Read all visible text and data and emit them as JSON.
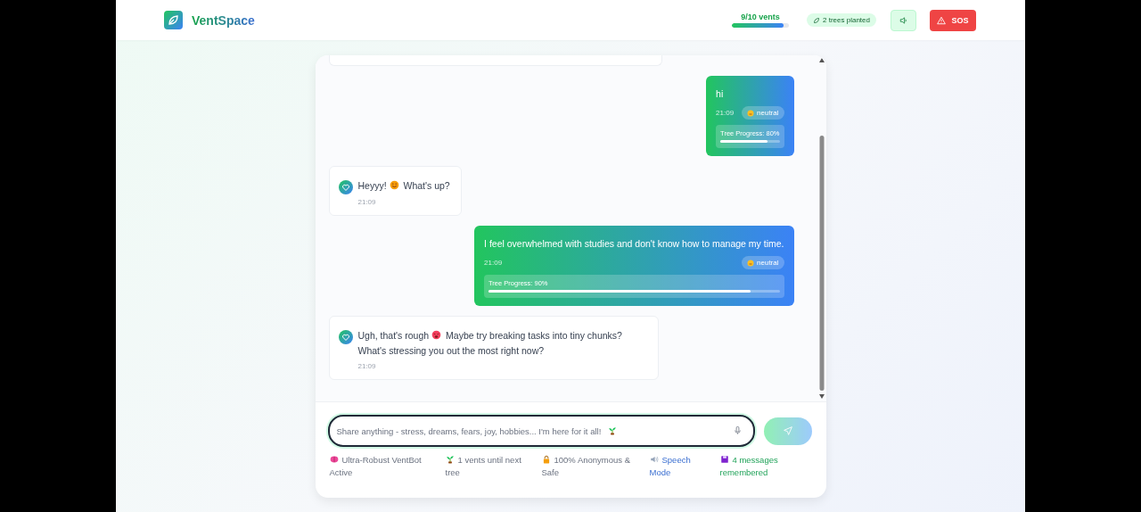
{
  "header": {
    "brand": "VentSpace",
    "vents": {
      "label": "9/10 vents",
      "level": 0.9
    },
    "trees_badge": "2 trees planted",
    "sos_button": "SOS"
  },
  "messages": [
    {
      "kind": "user",
      "parts": [
        {
          "kind": "text",
          "text": "hi"
        }
      ],
      "time": "21:09",
      "mood": "neutral",
      "progress": {
        "label": "Tree Progress: 80%",
        "level": 0.8
      }
    },
    {
      "kind": "bot",
      "parts": [
        {
          "kind": "text",
          "text": "Heyyy!"
        },
        {
          "kind": "smile"
        },
        {
          "kind": "text",
          "text": "What's up?"
        }
      ],
      "time": "21:09"
    },
    {
      "kind": "user",
      "parts": [
        {
          "kind": "text",
          "text": "I feel overwhelmed with studies and don't know how to manage my time."
        }
      ],
      "time": "21:09",
      "mood": "neutral",
      "progress": {
        "label": "Tree Progress: 90%",
        "level": 0.9
      }
    },
    {
      "kind": "bot",
      "parts": [
        {
          "kind": "text",
          "text": "Ugh, that's rough"
        },
        {
          "kind": "frown"
        },
        {
          "kind": "text",
          "text": "Maybe try breaking tasks into tiny chunks? What's stressing you out the most right now?"
        }
      ],
      "time": "21:09"
    }
  ],
  "composer": {
    "placeholder": "Share anything - stress, dreams, fears, joy, hobbies... I'm here for it all!"
  },
  "footer": [
    {
      "kind": "brain",
      "text": "Ultra-Robust VentBot Active"
    },
    {
      "kind": "sprout",
      "text": "1 vents until next tree"
    },
    {
      "kind": "lock",
      "text": "100% Anonymous & Safe"
    },
    {
      "kind": "speaker",
      "text": "Speech Mode"
    },
    {
      "kind": "disk",
      "text": "4 messages remembered"
    }
  ]
}
